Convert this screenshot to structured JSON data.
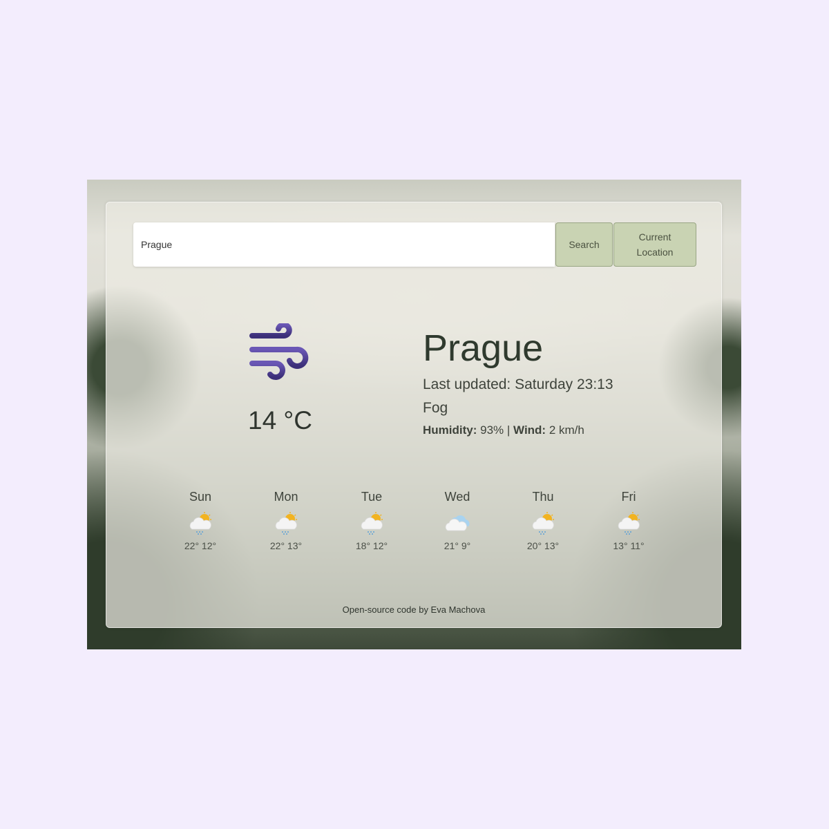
{
  "search": {
    "value": "Prague",
    "search_label": "Search",
    "location_label_line1": "Current",
    "location_label_line2": "Location"
  },
  "current": {
    "icon": "wind-icon",
    "temperature": "14 °C",
    "city": "Prague",
    "last_updated": "Last updated: Saturday 23:13",
    "condition": "Fog",
    "humidity_label": "Humidity:",
    "humidity_value": "93%",
    "separator": "|",
    "wind_label": "Wind:",
    "wind_value": "2 km/h"
  },
  "forecast": [
    {
      "day": "Sun",
      "icon": "partly-cloudy-rain-icon",
      "temps": "22° 12°"
    },
    {
      "day": "Mon",
      "icon": "partly-cloudy-rain-icon",
      "temps": "22° 13°"
    },
    {
      "day": "Tue",
      "icon": "partly-cloudy-rain-icon",
      "temps": "18° 12°"
    },
    {
      "day": "Wed",
      "icon": "cloudy-icon",
      "temps": "21° 9°"
    },
    {
      "day": "Thu",
      "icon": "partly-cloudy-rain-icon",
      "temps": "20° 13°"
    },
    {
      "day": "Fri",
      "icon": "partly-cloudy-rain-icon",
      "temps": "13° 11°"
    }
  ],
  "footer": "Open-source code by Eva Machova",
  "colors": {
    "accent_icon": "#5b4a9e",
    "button_bg": "#c9d3b3",
    "page_bg": "#f3edfd"
  }
}
